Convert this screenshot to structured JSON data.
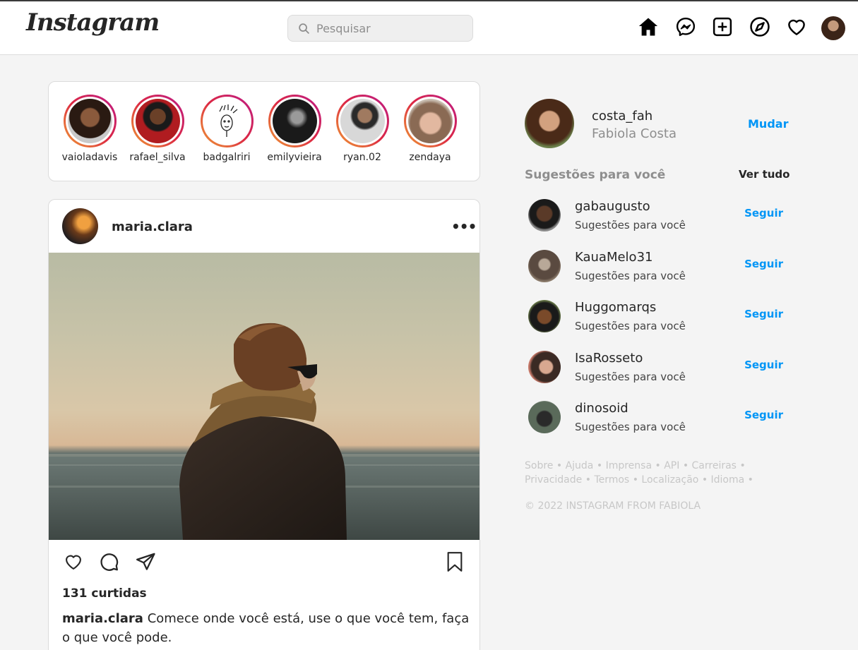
{
  "header": {
    "logo": "Instagram",
    "search_placeholder": "Pesquisar"
  },
  "icons": {
    "home": "home-icon",
    "messenger": "messenger-icon",
    "new_post": "plus-square-icon",
    "explore": "compass-icon",
    "activity": "heart-icon"
  },
  "stories": [
    {
      "name": "vaioladavis"
    },
    {
      "name": "rafael_silva"
    },
    {
      "name": "badgalriri"
    },
    {
      "name": "emilyvieira"
    },
    {
      "name": "ryan.02"
    },
    {
      "name": "zendaya"
    }
  ],
  "post": {
    "user": "maria.clara",
    "more": "•••",
    "likes": "131 curtidas",
    "caption_user": "maria.clara",
    "caption_text": "Comece onde você está, use o que você tem, faça o que você pode."
  },
  "sidebar": {
    "username": "costa_fah",
    "full_name": "Fabiola Costa",
    "switch_label": "Mudar",
    "suggestions_title": "Sugestões para você",
    "see_all": "Ver tudo",
    "suggestions": [
      {
        "user": "gabaugusto",
        "sub": "Sugestões para você",
        "follow": "Seguir"
      },
      {
        "user": "KauaMelo31",
        "sub": "Sugestões para você",
        "follow": "Seguir"
      },
      {
        "user": "Huggomarqs",
        "sub": "Sugestões para você",
        "follow": "Seguir"
      },
      {
        "user": "IsaRosseto",
        "sub": "Sugestões para você",
        "follow": "Seguir"
      },
      {
        "user": "dinosoid",
        "sub": "Sugestões para você",
        "follow": "Seguir"
      }
    ],
    "footer_links": [
      "Sobre",
      "Ajuda",
      "Imprensa",
      "API",
      "Carreiras",
      "Privacidade",
      "Termos",
      "Localização",
      "Idioma"
    ],
    "footer_separator": "•",
    "copyright": "© 2022 INSTAGRAM FROM FABIOLA"
  },
  "colors": {
    "accent": "#0095f6",
    "background": "#f4f4f4",
    "muted": "#8e8e8e"
  }
}
